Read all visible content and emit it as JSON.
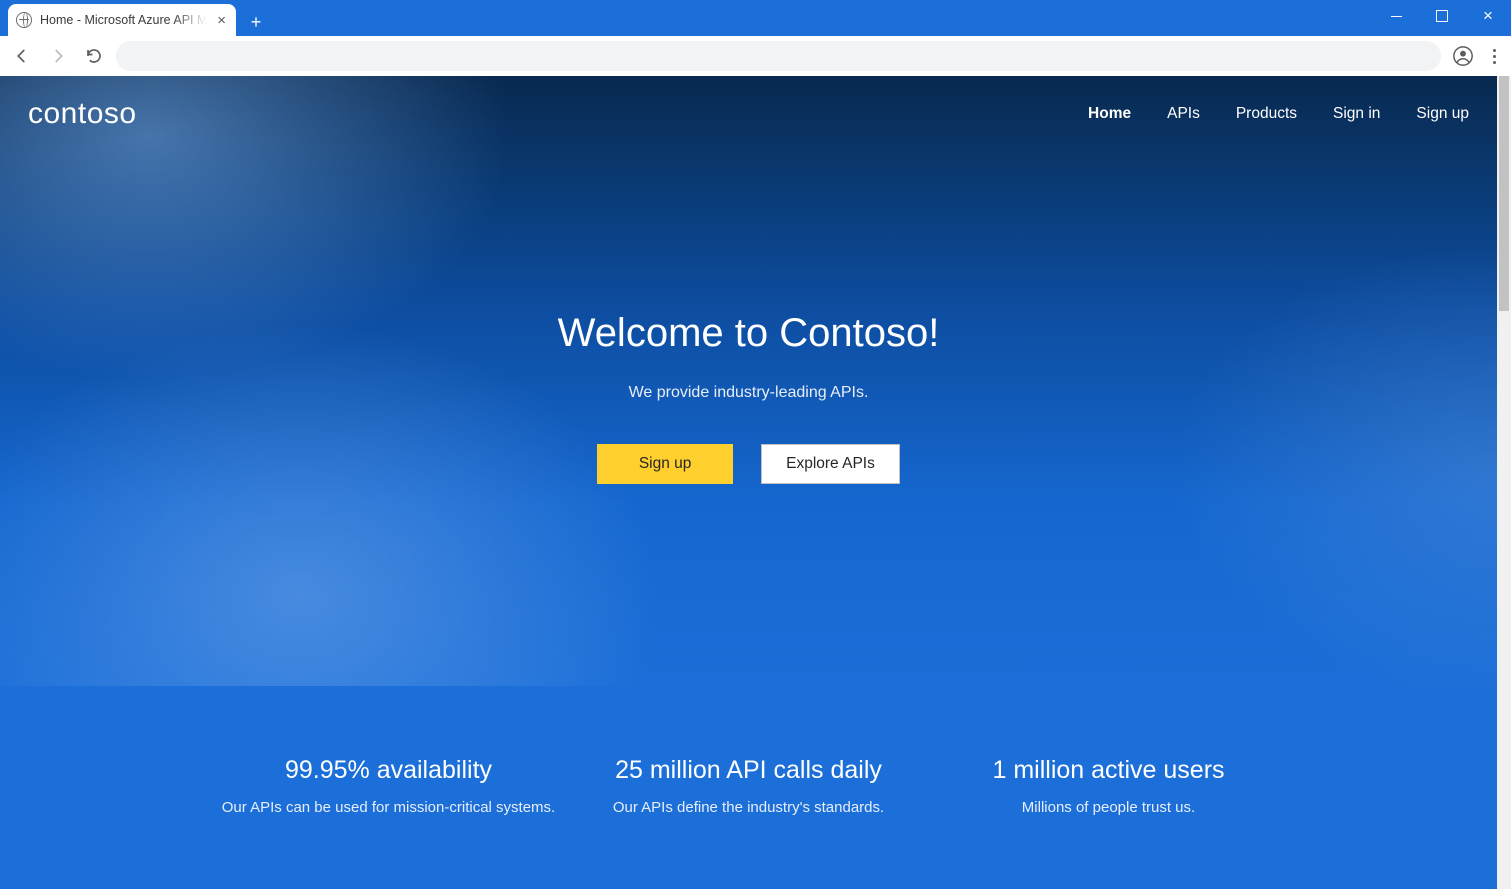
{
  "browser": {
    "tab_title": "Home - Microsoft Azure API Man"
  },
  "header": {
    "logo": "contoso",
    "nav": {
      "home": "Home",
      "apis": "APIs",
      "products": "Products",
      "signin": "Sign in",
      "signup": "Sign up"
    }
  },
  "hero": {
    "title": "Welcome to Contoso!",
    "subtitle": "We provide industry-leading APIs.",
    "cta_primary": "Sign up",
    "cta_secondary": "Explore APIs"
  },
  "stats": [
    {
      "headline": "99.95% availability",
      "sub": "Our APIs can be used for mission-critical systems."
    },
    {
      "headline": "25 million API calls daily",
      "sub": "Our APIs define the industry's standards."
    },
    {
      "headline": "1 million active users",
      "sub": "Millions of people trust us."
    }
  ]
}
